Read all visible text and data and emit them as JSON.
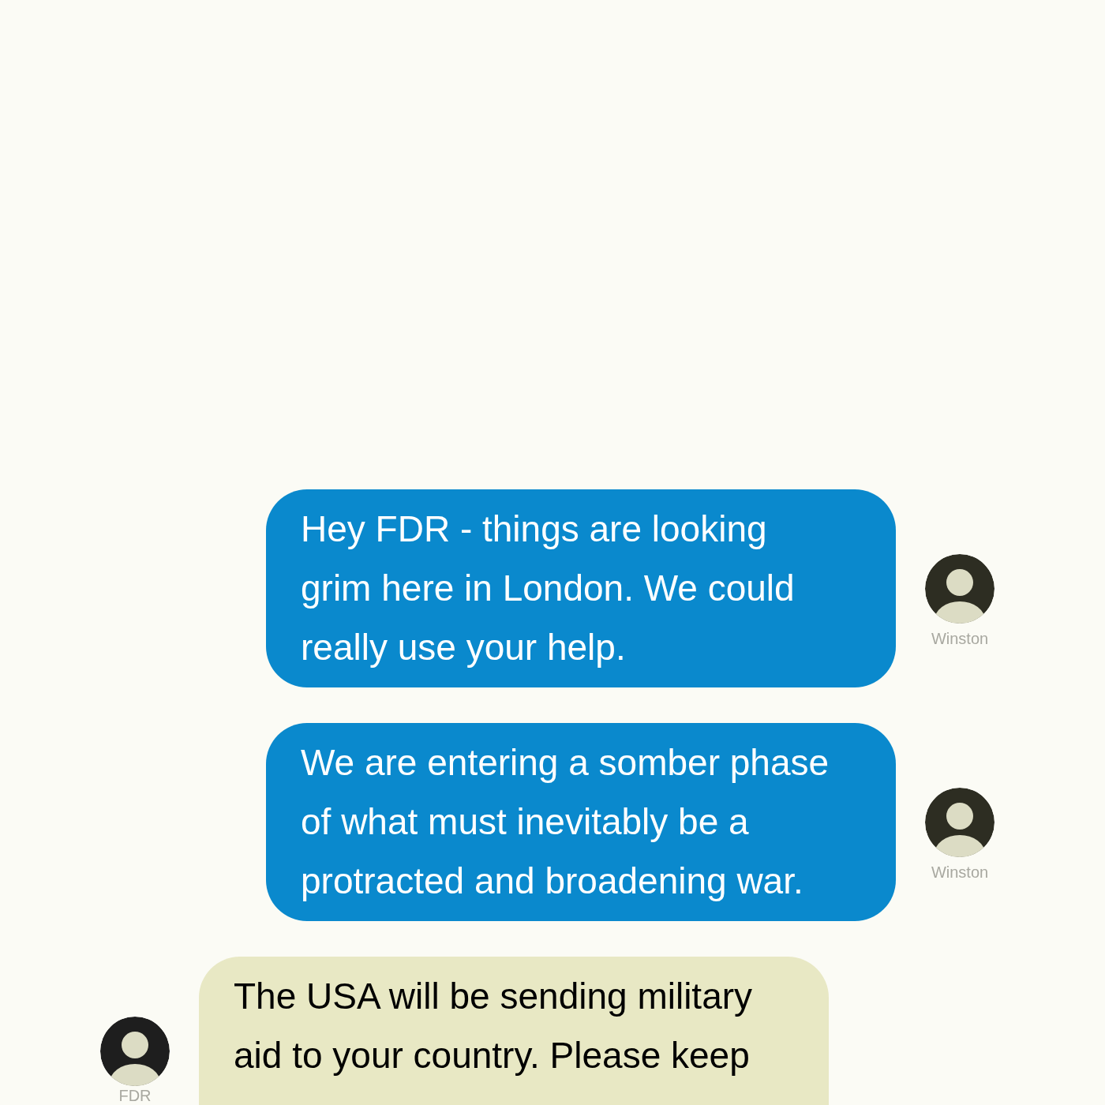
{
  "messages": [
    {
      "kind": "sent",
      "text": "Hey FDR - things are looking grim here in London. We could really use your help.",
      "sender": "Winston"
    },
    {
      "kind": "sent",
      "text": "We are entering a somber phase of what must inevitably be a protracted and broadening war.",
      "sender": "Winston"
    },
    {
      "kind": "received",
      "text": "The USA will be sending military aid to your country. Please keep",
      "sender": "FDR"
    }
  ]
}
